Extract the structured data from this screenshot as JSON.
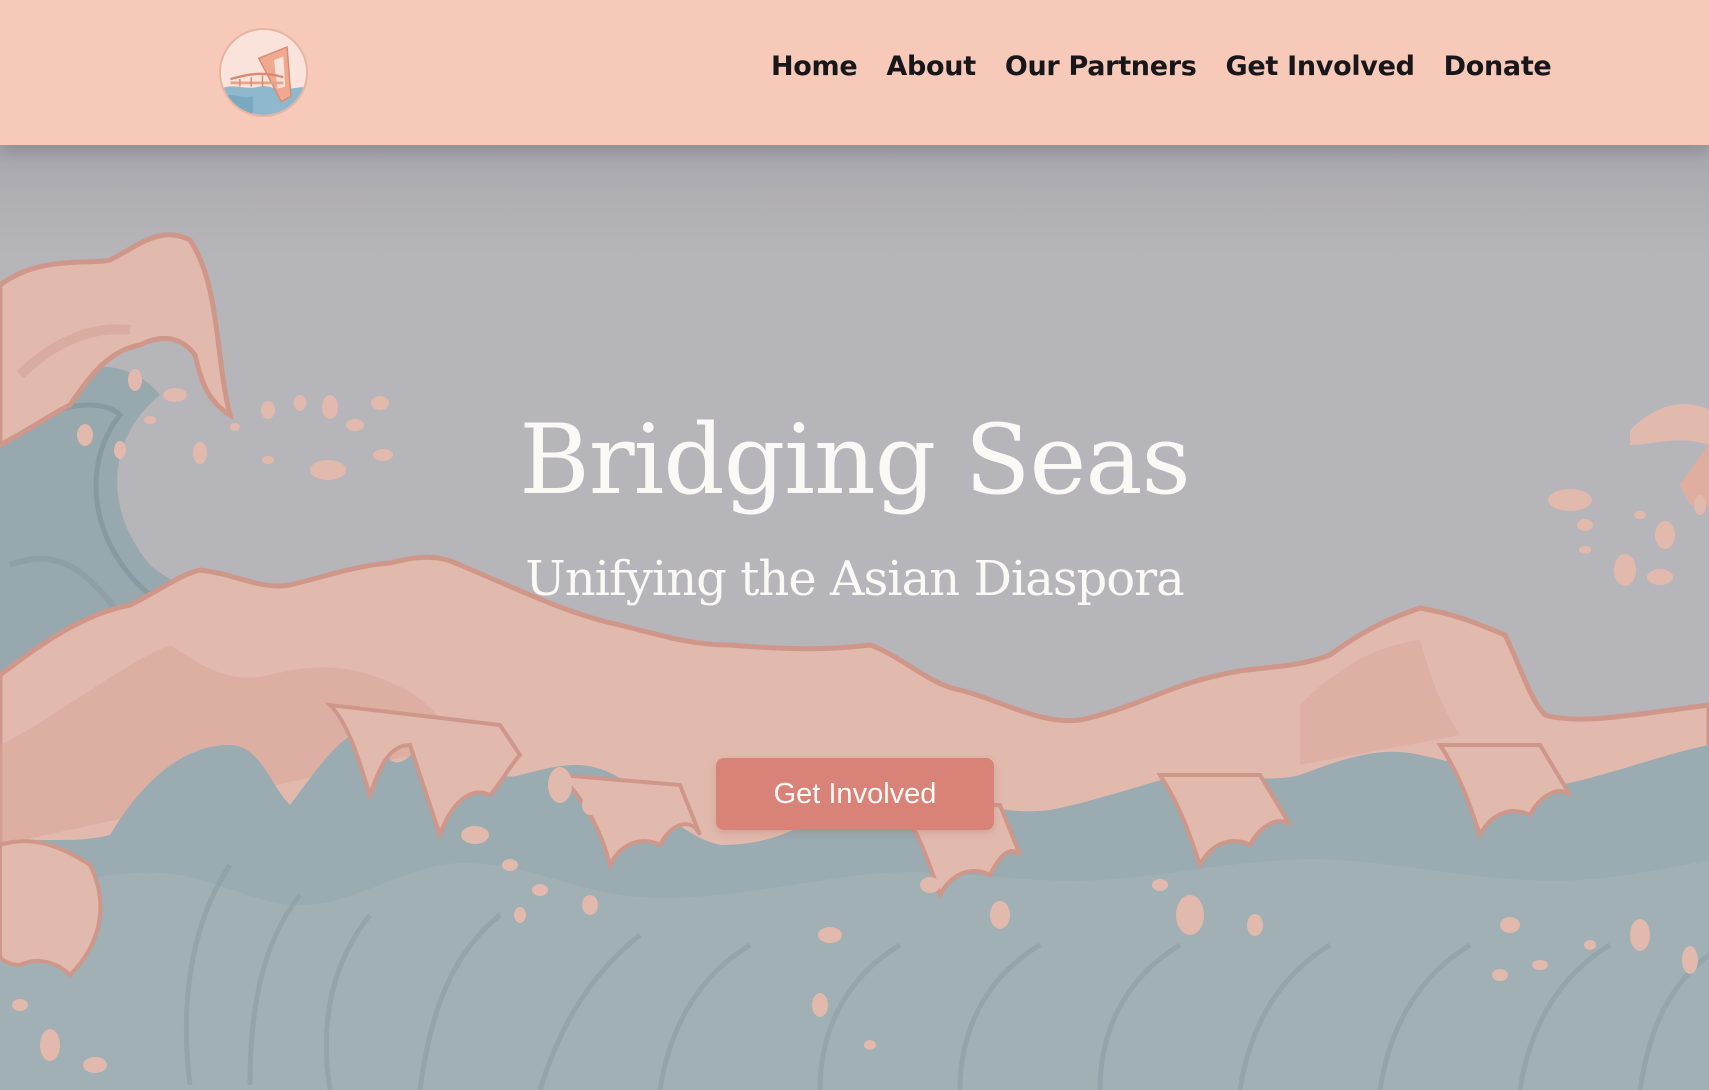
{
  "nav": {
    "logo_icon": "bridging-seas-logo",
    "links": [
      {
        "label": "Home"
      },
      {
        "label": "About"
      },
      {
        "label": "Our Partners"
      },
      {
        "label": "Get Involved"
      },
      {
        "label": "Donate"
      }
    ]
  },
  "hero": {
    "title": "Bridging Seas",
    "subtitle": "Unifying the Asian Diaspora",
    "cta_label": "Get Involved",
    "background_art": "great-wave-illustration"
  },
  "colors": {
    "nav_background": "#f6c9b8",
    "hero_background": "#b6b5ba",
    "wave_pink": "#e2b9ad",
    "wave_blue": "#97a8ae",
    "cta_background": "#d98278",
    "nav_text": "#17171b",
    "hero_text": "#fbf9f6"
  }
}
